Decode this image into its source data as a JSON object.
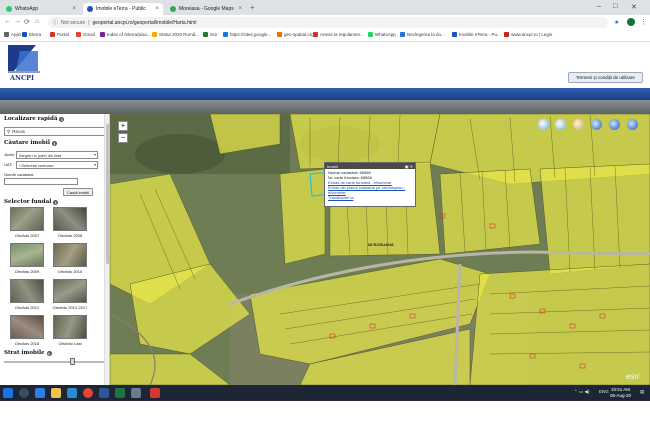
{
  "browser": {
    "tabs": [
      {
        "title": "WhatsApp",
        "active": false,
        "favicon_color": "#25d366"
      },
      {
        "title": "Imobile eTerra - Public",
        "active": true,
        "favicon_color": "#1a53b8"
      },
      {
        "title": "Moreiasa - Google Maps",
        "active": false,
        "favicon_color": "#34a853"
      }
    ],
    "url_security": "Not secure",
    "url": "geoportal.ancpi.ro/geoportal/imobile/Harta.html",
    "bookmarks": [
      {
        "label": "Apps",
        "color": "#5f6368"
      },
      {
        "label": "Eterra",
        "color": "#1a53b8"
      },
      {
        "label": "Portal",
        "color": "#d93025"
      },
      {
        "label": "Gmail",
        "color": "#ea4335"
      },
      {
        "label": "Index of /eterra/pisa...",
        "color": "#7b1fa2"
      },
      {
        "label": "Statut 2020 Româ...",
        "color": "#f9ab00"
      },
      {
        "label": "SUI",
        "color": "#188038"
      },
      {
        "label": "https://sites.google...",
        "color": "#1a73e8"
      },
      {
        "label": "geo-spatial.org",
        "color": "#e37400"
      },
      {
        "label": "Anexe la regulamen...",
        "color": "#d93025"
      },
      {
        "label": "WhatsApp",
        "color": "#25d366"
      },
      {
        "label": "Neclegerea la do...",
        "color": "#1a73e8"
      },
      {
        "label": "Imobile eTerra - Pu...",
        "color": "#1a53b8"
      },
      {
        "label": "www.ancpi.ro | Legis",
        "color": "#c5221f"
      }
    ]
  },
  "header": {
    "logo_text": "ANCPI",
    "terms_button": "Termeni și condiții de utilizare"
  },
  "sidebar": {
    "quick_locate_title": "Localizare rapidă",
    "search_value": "Recas",
    "search_title": "Căutare imobil",
    "judet_label": "Județ:",
    "judet_value": "Alegeți un județ din lista",
    "uat_label": "UAT:",
    "uat_value": "<Selectați comuna>",
    "cad_label": "Număr cadastral",
    "cad_value": "",
    "search_button": "Caută imobil",
    "basemap_title": "Selector fundal",
    "basemaps": [
      {
        "label": "Ortofoto 2007"
      },
      {
        "label": "Ortofoto 2008"
      },
      {
        "label": "Ortofoto 2009"
      },
      {
        "label": "Ortofoto 2010"
      },
      {
        "label": "Ortofoto 2012"
      },
      {
        "label": "Ortofoto 2012-2017"
      },
      {
        "label": "Ortofoto 2018"
      },
      {
        "label": "Ortofoto Last"
      }
    ],
    "layer_title": "Strat imobile"
  },
  "map": {
    "zoom_in": "+",
    "zoom_out": "−",
    "popup": {
      "title": "Imobil",
      "line1": "Numar cadastral: 65566",
      "line2": "Nr. carte funciara: 65566",
      "link1": "Extras de carte funciară - eNumerar",
      "link2": "Extras din planul cadastral pe ortofotoplan - eNumerar",
      "link3": "Transfocare la"
    },
    "label_parcel": "68 ROSUAHA",
    "attribution": "esri"
  },
  "taskbar": {
    "lang": "ENG",
    "time": "10:51 AM",
    "date": "06-Aug-20"
  }
}
